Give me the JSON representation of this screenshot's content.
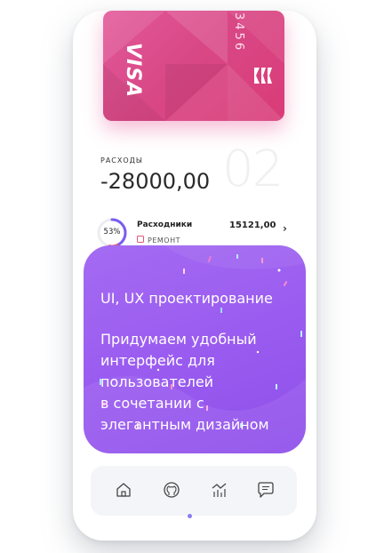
{
  "card": {
    "brand": "VISA",
    "number_fragment": "3456",
    "colors": {
      "primary": "#dd4d8c",
      "shadow": "#e6468c"
    }
  },
  "expenses": {
    "label": "РАСХОДЫ",
    "amount": "-28000,00",
    "page_number": "02"
  },
  "transaction": {
    "percent_label": "53%",
    "percent": 0.53,
    "name": "Расходники",
    "category": "РЕМОНТ",
    "value": "15121,00",
    "chevron": "›",
    "ring_color": "#7a5cf0",
    "accent_color": "#e2577a"
  },
  "promo": {
    "title": "UI, UX проектирование",
    "lines": [
      "Придумаем удобный",
      "интерфейс для",
      "пользователей",
      "в сочетании с",
      "элегантным дизайном"
    ],
    "color": "#9b5df0"
  },
  "nav": {
    "items": [
      {
        "icon": "home-icon"
      },
      {
        "icon": "github-icon"
      },
      {
        "icon": "chart-icon"
      },
      {
        "icon": "chat-icon"
      }
    ],
    "active_index": 1,
    "active_color": "#8a7df5"
  }
}
